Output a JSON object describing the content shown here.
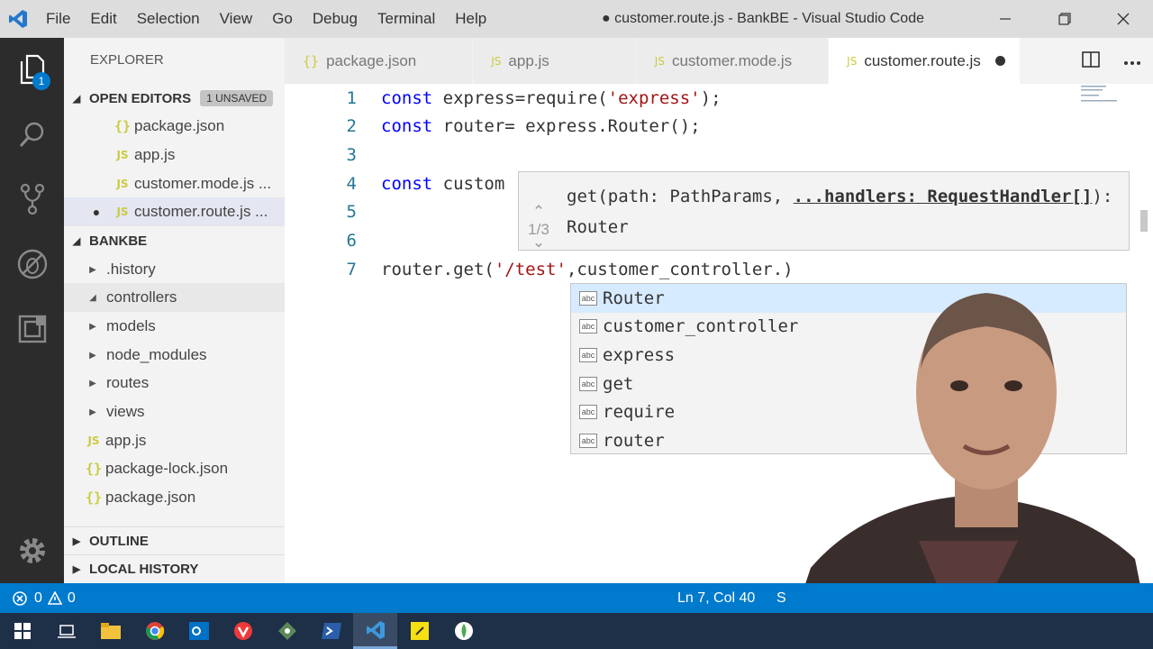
{
  "titlebar": {
    "menu": [
      "File",
      "Edit",
      "Selection",
      "View",
      "Go",
      "Debug",
      "Terminal",
      "Help"
    ],
    "title": "● customer.route.js - BankBE - Visual Studio Code"
  },
  "activity": {
    "badge": "1"
  },
  "sidebar": {
    "title": "EXPLORER",
    "open_editors": {
      "label": "OPEN EDITORS",
      "unsaved": "1 UNSAVED",
      "items": [
        {
          "icon": "{}",
          "label": "package.json"
        },
        {
          "icon": "JS",
          "label": "app.js"
        },
        {
          "icon": "JS",
          "label": "customer.mode.js ..."
        },
        {
          "icon": "JS",
          "label": "customer.route.js ..."
        }
      ]
    },
    "project": {
      "label": "BANKBE",
      "folders": [
        ".history",
        "controllers",
        "models",
        "node_modules",
        "routes",
        "views"
      ],
      "files": [
        {
          "icon": "JS",
          "label": "app.js"
        },
        {
          "icon": "{}",
          "label": "package-lock.json"
        },
        {
          "icon": "{}",
          "label": "package.json"
        }
      ]
    },
    "outline": "OUTLINE",
    "local_history": "LOCAL HISTORY"
  },
  "tabs": [
    {
      "icon": "{}",
      "label": "package.json"
    },
    {
      "icon": "JS",
      "label": "app.js"
    },
    {
      "icon": "JS",
      "label": "customer.mode.js"
    },
    {
      "icon": "JS",
      "label": "customer.route.js"
    }
  ],
  "editor": {
    "line_numbers": [
      "1",
      "2",
      "3",
      "4",
      "5",
      "6",
      "7"
    ],
    "line1": {
      "kw": "const",
      "a": " express=require(",
      "str": "'express'",
      "b": ");"
    },
    "line2": {
      "kw": "const",
      "a": " router= express.Router();"
    },
    "line4": {
      "kw": "const",
      "a": " custom"
    },
    "line7": {
      "a": "router.get(",
      "str": "'/test'",
      "b": ",customer_controller.)"
    }
  },
  "param_hint": {
    "counter": "1/3",
    "sig_start": "get(path: PathParams, ",
    "sig_param": "...handlers: RequestHandler[]",
    "sig_end": "): Router"
  },
  "suggestions": {
    "kind_label": "abc",
    "items": [
      "Router",
      "customer_controller",
      "express",
      "get",
      "require",
      "router"
    ]
  },
  "statusbar": {
    "errors": "0",
    "warnings": "0",
    "position": "Ln 7, Col 40",
    "spaces": "S"
  },
  "colors": {
    "accent": "#007acc",
    "keyword": "#0000ff",
    "string": "#a31515",
    "line_number": "#237893"
  }
}
